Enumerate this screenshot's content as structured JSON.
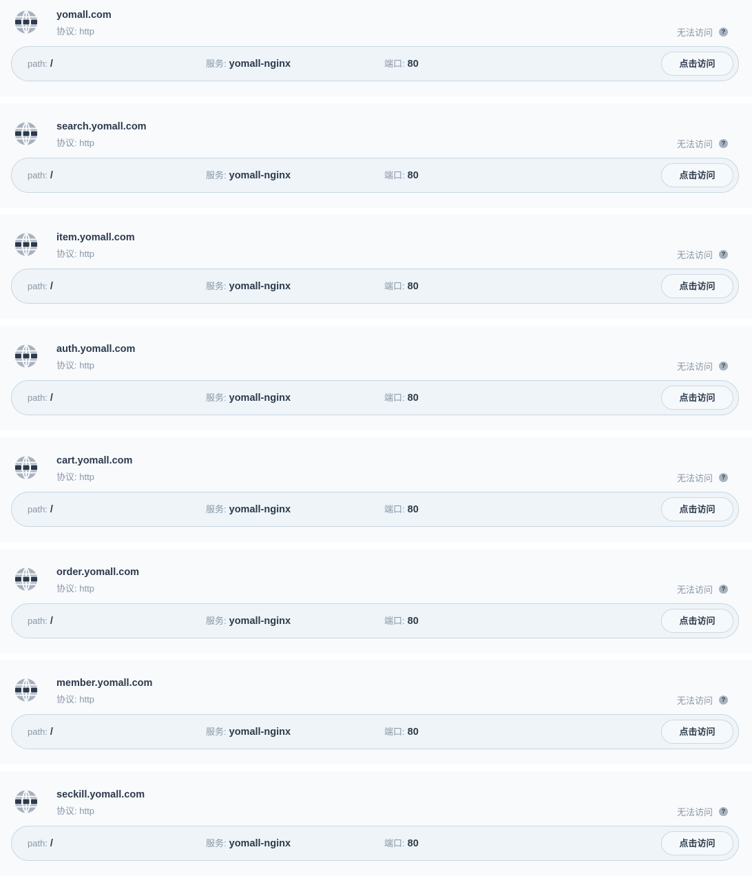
{
  "labels": {
    "protocol_prefix": "协议:",
    "path_key": "path:",
    "service_key": "服务:",
    "port_key": "端口:",
    "visit_button": "点击访问",
    "help_glyph": "?"
  },
  "colors": {
    "card_bg": "#f8fafc",
    "route_bg": "#eef4f8",
    "text_primary": "#2c3a4b",
    "text_muted": "#8a96a5",
    "globe_band": "#2c3a4b",
    "globe_body": "#a8b2be"
  },
  "icons": {
    "domain": "globe-icon",
    "help": "question-circle-icon"
  },
  "ingresses": [
    {
      "host": "yomall.com",
      "protocol": "http",
      "status": "无法访问",
      "path": "/",
      "service": "yomall-nginx",
      "port": "80"
    },
    {
      "host": "search.yomall.com",
      "protocol": "http",
      "status": "无法访问",
      "path": "/",
      "service": "yomall-nginx",
      "port": "80"
    },
    {
      "host": "item.yomall.com",
      "protocol": "http",
      "status": "无法访问",
      "path": "/",
      "service": "yomall-nginx",
      "port": "80"
    },
    {
      "host": "auth.yomall.com",
      "protocol": "http",
      "status": "无法访问",
      "path": "/",
      "service": "yomall-nginx",
      "port": "80"
    },
    {
      "host": "cart.yomall.com",
      "protocol": "http",
      "status": "无法访问",
      "path": "/",
      "service": "yomall-nginx",
      "port": "80"
    },
    {
      "host": "order.yomall.com",
      "protocol": "http",
      "status": "无法访问",
      "path": "/",
      "service": "yomall-nginx",
      "port": "80"
    },
    {
      "host": "member.yomall.com",
      "protocol": "http",
      "status": "无法访问",
      "path": "/",
      "service": "yomall-nginx",
      "port": "80"
    },
    {
      "host": "seckill.yomall.com",
      "protocol": "http",
      "status": "无法访问",
      "path": "/",
      "service": "yomall-nginx",
      "port": "80"
    }
  ]
}
